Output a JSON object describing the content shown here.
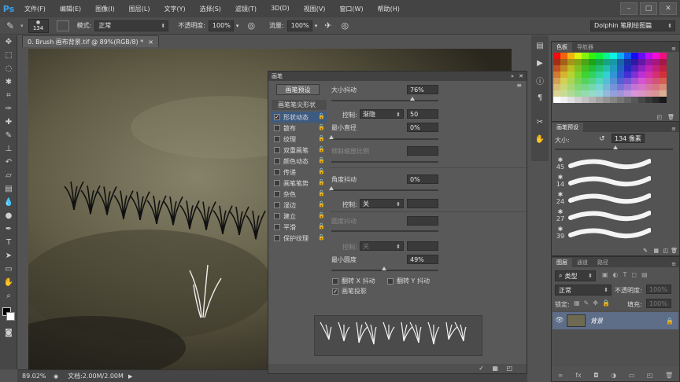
{
  "app": {
    "logo": "Ps"
  },
  "menubar": {
    "items": [
      "文件(F)",
      "编辑(E)",
      "图像(I)",
      "图层(L)",
      "文字(Y)",
      "选择(S)",
      "滤镜(T)",
      "3D(D)",
      "视图(V)",
      "窗口(W)",
      "帮助(H)"
    ]
  },
  "options": {
    "brush_size": "134",
    "mode_label": "模式:",
    "mode_value": "正常",
    "opacity_label": "不透明度:",
    "opacity_value": "100%",
    "flow_label": "流量:",
    "flow_value": "100%",
    "preset": "Dolphin 笔刷绘图篇"
  },
  "document": {
    "tab_title": "0. Brush 画布背景.tif @ 89%(RGB/8) *",
    "close": "×"
  },
  "status": {
    "zoom": "89.02%",
    "doc_info": "文档:2.00M/2.00M"
  },
  "brush_panel": {
    "title": "画笔",
    "preset_button": "画笔预设",
    "tip_shape": "画笔笔尖形状",
    "items": [
      {
        "label": "形状动态",
        "checked": true,
        "selected": true
      },
      {
        "label": "散布",
        "checked": false
      },
      {
        "label": "纹理",
        "checked": false
      },
      {
        "label": "双重画笔",
        "checked": false
      },
      {
        "label": "颜色动态",
        "checked": false
      },
      {
        "label": "传递",
        "checked": false
      },
      {
        "label": "画笔笔势",
        "checked": false
      },
      {
        "label": "杂色",
        "checked": false
      },
      {
        "label": "湿边",
        "checked": false
      },
      {
        "label": "建立",
        "checked": false
      },
      {
        "label": "平滑",
        "checked": false
      },
      {
        "label": "保护纹理",
        "checked": false
      }
    ],
    "size_jitter_label": "大小抖动",
    "size_jitter_value": "76%",
    "control1_label": "控制:",
    "control1_value": "渐隐",
    "control1_steps": "50",
    "min_diameter_label": "最小直径",
    "min_diameter_value": "0%",
    "tilt_scale_label": "倾斜缩放比例",
    "angle_jitter_label": "角度抖动",
    "angle_jitter_value": "0%",
    "control2_label": "控制:",
    "control2_value": "关",
    "roundness_jitter_label": "圆度抖动",
    "control3_label": "控制:",
    "control3_value": "关",
    "min_roundness_label": "最小圆度",
    "min_roundness_value": "49%",
    "flip_x": "翻转 X 抖动",
    "flip_y": "翻转 Y 抖动",
    "brush_projection": "画笔投影",
    "size_jitter_level": 0.76,
    "min_diameter_level": 0.0,
    "angle_jitter_level": 0.0,
    "min_roundness_level": 0.49
  },
  "color_panel": {
    "tabs": [
      "色板",
      "导航器"
    ]
  },
  "brush_presets_panel": {
    "tab": "画笔预设",
    "size_label": "大小:",
    "size_value": "134 像素",
    "sizes": [
      "45",
      "14",
      "24",
      "27",
      "39"
    ]
  },
  "layers_panel": {
    "tabs": [
      "图层",
      "通道",
      "路径"
    ],
    "filter": "类型",
    "blend_mode": "正常",
    "opacity_label": "不透明度:",
    "opacity_value": "100%",
    "lock_label": "锁定:",
    "fill_label": "填充:",
    "fill_value": "100%",
    "layer_name": "背景"
  },
  "colors": {
    "accent": "#3d5a80",
    "layer_selected": "#5e6d88",
    "canvas_dark": "#2f2b22",
    "canvas_light": "#7f7b60"
  }
}
